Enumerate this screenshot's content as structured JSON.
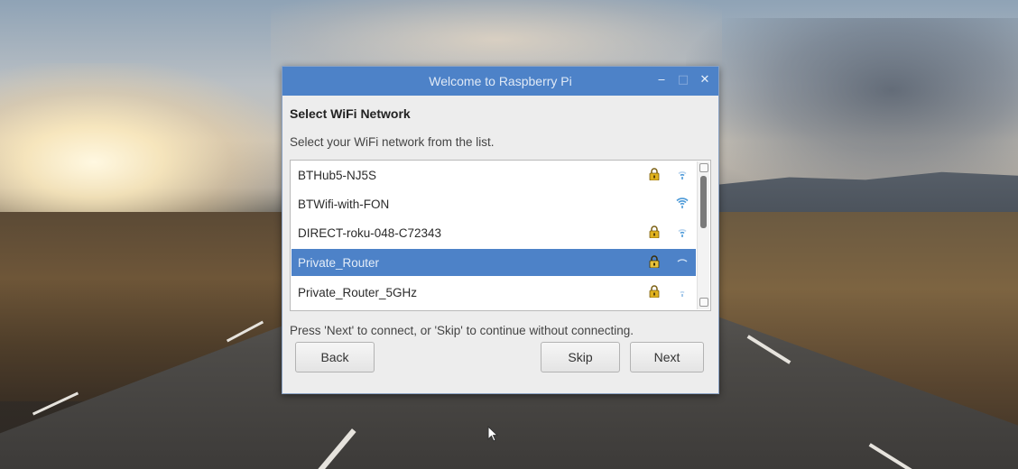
{
  "window": {
    "title": "Welcome to Raspberry Pi",
    "controls": [
      "minimize",
      "maximize",
      "close"
    ]
  },
  "page": {
    "heading": "Select WiFi Network",
    "instruction": "Select your WiFi network from the list.",
    "hint": "Press 'Next' to connect, or 'Skip' to continue without connecting."
  },
  "networks": [
    {
      "name": "BTHub5-NJ5S",
      "secured": true,
      "icon": "wifi-icon",
      "selected": false
    },
    {
      "name": "BTWifi-with-FON",
      "secured": false,
      "icon": "wifi-icon",
      "selected": false
    },
    {
      "name": "DIRECT-roku-048-C72343",
      "secured": true,
      "icon": "wifi-icon",
      "selected": false
    },
    {
      "name": "Private_Router",
      "secured": true,
      "icon": "wifi-icon",
      "selected": true
    },
    {
      "name": "Private_Router_5GHz",
      "secured": true,
      "icon": "wifi-icon",
      "selected": false
    }
  ],
  "buttons": {
    "back": "Back",
    "skip": "Skip",
    "next": "Next"
  },
  "colors": {
    "accent": "#4d82c8",
    "lock": "#e0b21e",
    "wifi": "#4d9ad8"
  }
}
